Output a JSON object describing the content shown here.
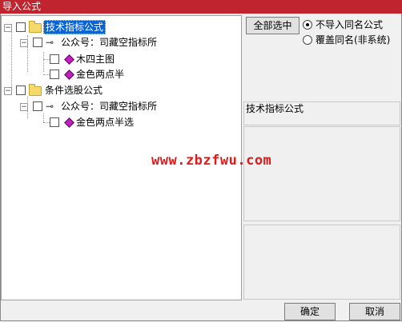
{
  "window": {
    "title": "导入公式"
  },
  "tree": {
    "nodes": [
      {
        "label": "技术指标公式"
      },
      {
        "label": "公众号：司藏空指标所"
      },
      {
        "label": "木四主图"
      },
      {
        "label": "金色两点半"
      },
      {
        "label": "条件选股公式"
      },
      {
        "label": "公众号：司藏空指标所"
      },
      {
        "label": "金色两点半选"
      }
    ]
  },
  "options": {
    "select_all_label": "全部选中",
    "radio_no_import_label": "不导入同名公式",
    "radio_overwrite_label": "覆盖同名(非系统)",
    "selected": "no_import"
  },
  "detail": {
    "category_label": "技术指标公式"
  },
  "watermark": {
    "text": "www.zbzfwu.com"
  },
  "buttons": {
    "ok_label": "确定",
    "cancel_label": "取消"
  }
}
